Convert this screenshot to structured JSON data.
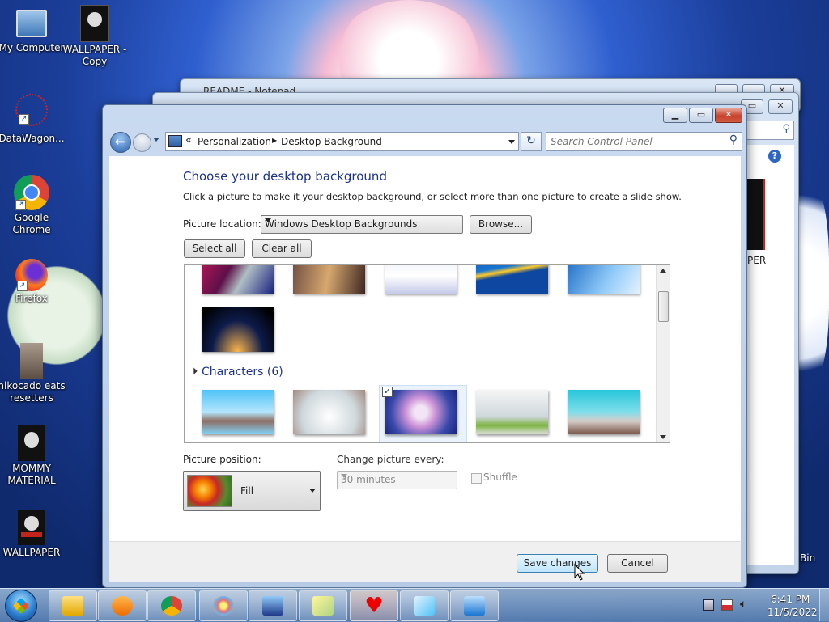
{
  "desktop": {
    "icons": [
      {
        "label": "My Computer",
        "icon": "computer-icon"
      },
      {
        "label": "WALLPAPER - Copy",
        "icon": "wallpaper-file-icon"
      },
      {
        "label": "DataWagon...",
        "icon": "datawagon-icon"
      },
      {
        "label": "Google Chrome",
        "icon": "chrome-icon"
      },
      {
        "label": "Firefox",
        "icon": "firefox-icon"
      },
      {
        "label": "nikocado eats resetters",
        "icon": "image-file-icon"
      },
      {
        "label": "MOMMY MATERIAL",
        "icon": "image-file-icon"
      },
      {
        "label": "WALLPAPER",
        "icon": "image-file-icon"
      }
    ],
    "partial_labels": {
      "paper": "PER",
      "bin": "Bin"
    }
  },
  "background_window": {
    "title": "README - Notepad"
  },
  "window": {
    "back_label": "Back",
    "forward_label": "Forward",
    "breadcrumb": {
      "root_glyph": "«",
      "items": [
        "Personalization",
        "Desktop Background"
      ],
      "separator": "▶"
    },
    "refresh_glyph": "↻",
    "search_placeholder": "Search Control Panel",
    "caption": {
      "minimize": "▁",
      "maximize": "▭",
      "close": "✕"
    }
  },
  "page": {
    "heading": "Choose your desktop background",
    "description": "Click a picture to make it your desktop background, or select more than one picture to create a slide show.",
    "picture_location_label": "Picture location:",
    "picture_location_value": "Windows Desktop Backgrounds",
    "browse_label": "Browse...",
    "select_all_label": "Select all",
    "clear_all_label": "Clear all",
    "group_name": "Characters (6)",
    "group_collapse_glyph": "◢",
    "selected_thumb_check": "✓",
    "picture_position_label": "Picture position:",
    "picture_position_value": "Fill",
    "change_every_label": "Change picture every:",
    "change_every_value": "30 minutes",
    "shuffle_label": "Shuffle",
    "shuffle_checked": false
  },
  "footer": {
    "save_label": "Save changes",
    "cancel_label": "Cancel"
  },
  "taskbar": {
    "start": "start-orb",
    "pinned": [
      "explorer-icon",
      "media-player-icon",
      "chrome-icon",
      "paint-icon",
      "keyboard-app-icon",
      "sticky-notes-icon",
      "heart-app-icon",
      "notepad-icon",
      "control-panel-icon"
    ],
    "clock_time": "6:41 PM",
    "clock_date": "11/5/2022",
    "tray": [
      "network-icon",
      "flag-icon",
      "volume-icon"
    ]
  },
  "colors": {
    "heading": "#1e3287",
    "accent": "#3c7fb1"
  }
}
